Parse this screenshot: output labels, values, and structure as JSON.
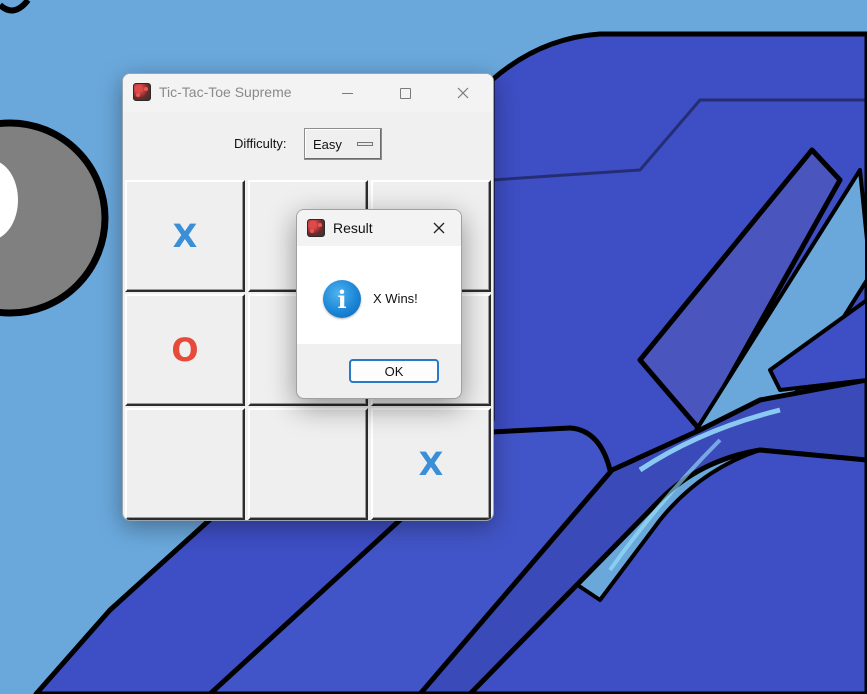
{
  "window": {
    "title": "Tic-Tac-Toe Supreme",
    "app_icon": "game-board-icon"
  },
  "difficulty": {
    "label": "Difficulty:",
    "value": "Easy"
  },
  "board": {
    "cells": [
      "X",
      "",
      "",
      "O",
      "",
      "",
      "",
      "",
      "X"
    ]
  },
  "dialog": {
    "title": "Result",
    "message": "X Wins!",
    "icon": "info-icon",
    "ok_label": "OK"
  },
  "colors": {
    "x_mark": "#3a8fd6",
    "o_mark": "#e64a3a",
    "ok_button_border": "#2a78c8",
    "wallpaper_sky": "#6aa8dc",
    "wallpaper_shape": "#3e4ec4"
  }
}
